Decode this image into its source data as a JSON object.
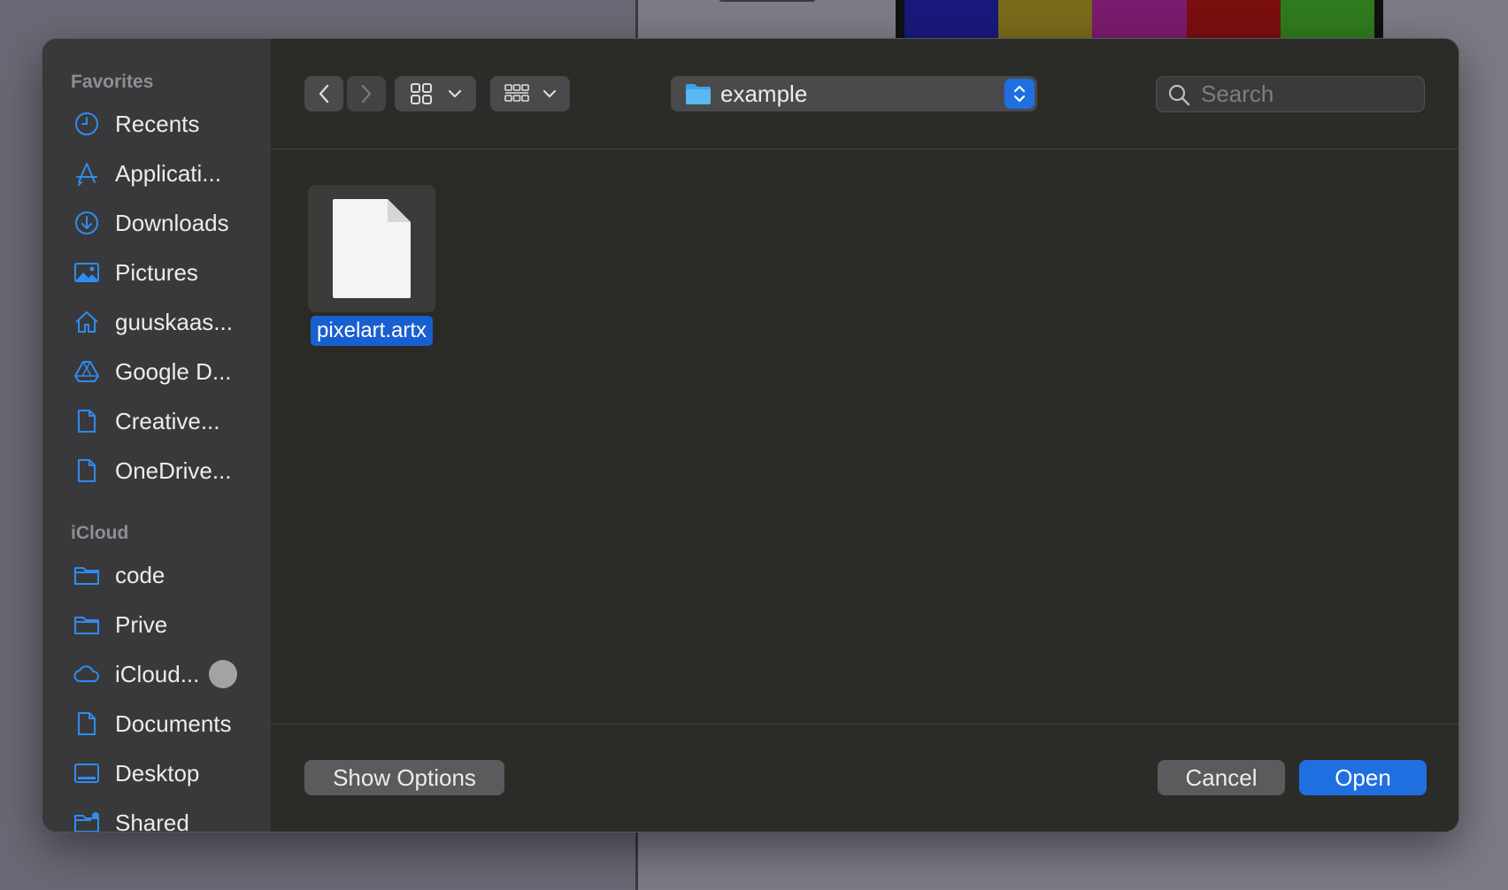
{
  "background": {
    "palette_colors": [
      "#18197a",
      "#7a6a1b",
      "#7b1b6e",
      "#7a0f0f",
      "#2f7a1d"
    ]
  },
  "sidebar": {
    "favorites_heading": "Favorites",
    "favorites": [
      {
        "label": "Recents",
        "icon": "clock-icon"
      },
      {
        "label": "Applicati...",
        "icon": "applications-icon"
      },
      {
        "label": "Downloads",
        "icon": "download-icon"
      },
      {
        "label": "Pictures",
        "icon": "pictures-icon"
      },
      {
        "label": "guuskaas...",
        "icon": "home-icon"
      },
      {
        "label": "Google D...",
        "icon": "google-drive-icon"
      },
      {
        "label": "Creative...",
        "icon": "document-icon"
      },
      {
        "label": "OneDrive...",
        "icon": "document-icon"
      }
    ],
    "icloud_heading": "iCloud",
    "icloud": [
      {
        "label": "code",
        "icon": "folder-icon"
      },
      {
        "label": "Prive",
        "icon": "folder-icon"
      },
      {
        "label": "iCloud...",
        "icon": "cloud-icon"
      },
      {
        "label": "Documents",
        "icon": "document-icon"
      },
      {
        "label": "Desktop",
        "icon": "desktop-icon"
      },
      {
        "label": "Shared",
        "icon": "shared-folder-icon"
      }
    ]
  },
  "toolbar": {
    "location": "example",
    "search_placeholder": "Search"
  },
  "files": [
    {
      "name": "pixelart.artx",
      "selected": true
    }
  ],
  "footer": {
    "show_options": "Show Options",
    "cancel": "Cancel",
    "open": "Open"
  },
  "colors": {
    "accent": "#1f6fe0",
    "sidebar_icon": "#2f8cf0"
  }
}
